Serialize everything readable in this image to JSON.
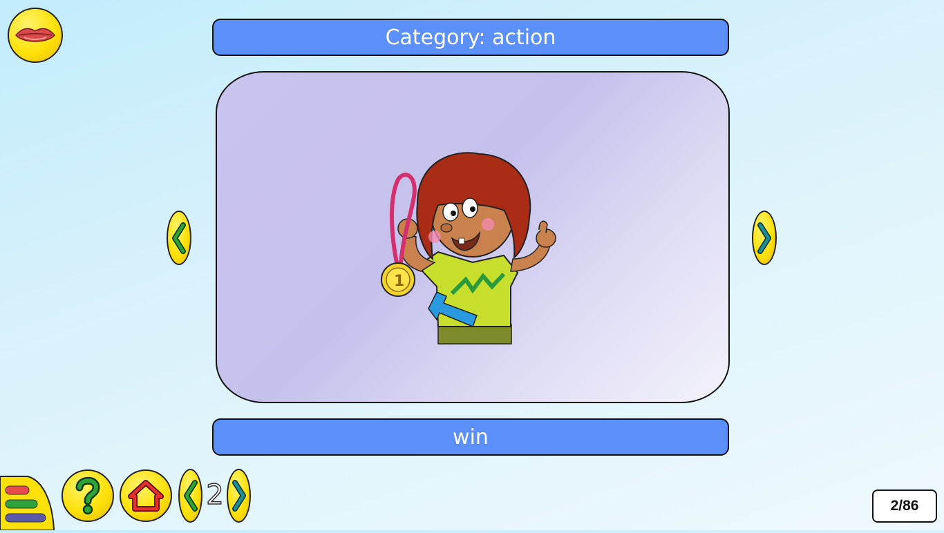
{
  "header": {
    "category_label": "Category: action"
  },
  "card": {
    "word": "win",
    "image_icon": "child-with-medal-illustration"
  },
  "pager": {
    "page_number": "2",
    "counter": "2/86"
  },
  "controls": {
    "speak_icon": "lips-icon",
    "help_icon": "question-mark-icon",
    "home_icon": "home-icon",
    "menu_icon": "menu-lines-icon"
  },
  "colors": {
    "bar": "#5b8ff9",
    "button_yellow": "#ffe10a",
    "arrow_green": "#1f8a2a",
    "arrow_teal": "#1a7f86"
  }
}
